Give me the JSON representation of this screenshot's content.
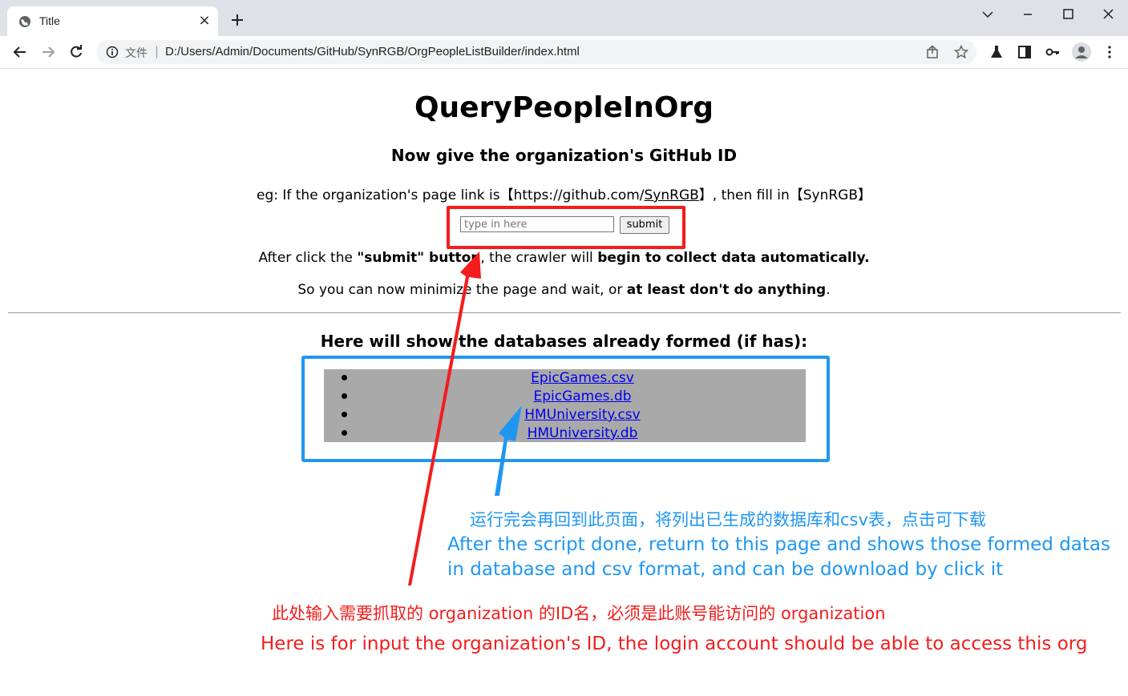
{
  "browser": {
    "tab_title": "Title",
    "close_glyph": "×",
    "scheme_label": "文件",
    "separator": "|",
    "url": "D:/Users/Admin/Documents/GitHub/SynRGB/OrgPeopleListBuilder/index.html"
  },
  "page": {
    "title": "QueryPeopleInOrg",
    "subtitle": "Now give the organization's GitHub ID",
    "example_prefix": "eg: If the organization's page link is【https://github.com/",
    "example_org_link": "SynRGB",
    "example_suffix": "】, then fill in【SynRGB】",
    "input_placeholder": "type in here",
    "submit_label": "submit",
    "after_click_a": "After click the ",
    "after_click_b": "\"submit\" button",
    "after_click_c": ", the crawler will ",
    "after_click_d": "begin to collect data automatically.",
    "minimize_a": "So you can now minimize the page and wait, or ",
    "minimize_b": "at least don't do anything",
    "minimize_c": ".",
    "databases_heading": "Here will show the databases already formed (if has):",
    "databases": [
      "EpicGames.csv",
      "EpicGames.db",
      "HMUniversity.csv",
      "HMUniversity.db"
    ]
  },
  "annotations": {
    "blue_zh": "运行完会再回到此页面，将列出已生成的数据库和csv表，点击可下载",
    "blue_en_1": "After the script done, return to this page and shows those formed datas",
    "blue_en_2": "in database and csv format, and can be download by click it",
    "red_zh": "此处输入需要抓取的 organization 的ID名，必须是此账号能访问的 organization",
    "red_en": "Here is for input the organization's ID, the login account should be able to access this org",
    "red_color": "#f41c1c",
    "blue_color": "#1f97f1"
  }
}
